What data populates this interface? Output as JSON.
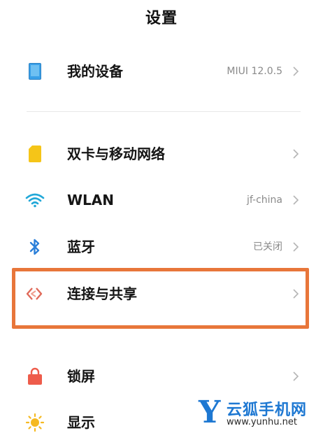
{
  "header": {
    "title": "设置"
  },
  "settings": [
    {
      "key": "my-device",
      "label": "我的设备",
      "value": "MIUI 12.0.5",
      "icon": "tablet-icon"
    },
    {
      "key": "dual-sim",
      "label": "双卡与移动网络",
      "value": "",
      "icon": "sim-card-icon"
    },
    {
      "key": "wlan",
      "label": "WLAN",
      "value": "jf-china",
      "icon": "wifi-icon"
    },
    {
      "key": "bluetooth",
      "label": "蓝牙",
      "value": "已关闭",
      "icon": "bluetooth-icon"
    },
    {
      "key": "connection-sharing",
      "label": "连接与共享",
      "value": "",
      "icon": "connection-sharing-icon"
    },
    {
      "key": "lock-screen",
      "label": "锁屏",
      "value": "",
      "icon": "lock-icon"
    },
    {
      "key": "display",
      "label": "显示",
      "value": "",
      "icon": "sun-icon"
    }
  ],
  "colors": {
    "highlight_border": "#e8763a",
    "device_icon": "#3aa0e8",
    "sim_icon": "#f5c518",
    "wifi_icon": "#22a8d8",
    "bluetooth_icon": "#2b7fd9",
    "sharing_icon": "#e06a5a",
    "lock_icon": "#ee5c4b",
    "sun_icon": "#f5b921",
    "watermark": "#1e78d2"
  },
  "watermark": {
    "logo_letter": "Y",
    "name": "云狐手机网",
    "url": "www.yunhu.net"
  }
}
